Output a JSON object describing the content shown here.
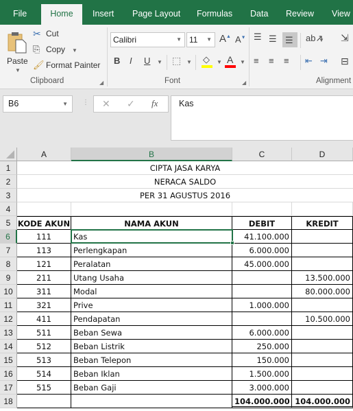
{
  "tabs": [
    "File",
    "Home",
    "Insert",
    "Page Layout",
    "Formulas",
    "Data",
    "Review",
    "View"
  ],
  "active_tab": "Home",
  "ribbon": {
    "clipboard": {
      "label": "Clipboard",
      "paste": "Paste",
      "cut": "Cut",
      "copy": "Copy",
      "format_painter": "Format Painter"
    },
    "font": {
      "label": "Font",
      "font_name": "Calibri",
      "font_size": "11",
      "bold": "B",
      "italic": "I",
      "underline": "U",
      "highlight_color": "#ffff00",
      "font_color": "#ff0000"
    },
    "alignment": {
      "label": "Alignment"
    }
  },
  "formula_bar": {
    "name_box": "B6",
    "cancel": "✕",
    "enter": "✓",
    "fx": "fx",
    "value": "Kas"
  },
  "columns": [
    "A",
    "B",
    "C",
    "D"
  ],
  "selected_column": "B",
  "selected_row": 6,
  "rows": [
    "1",
    "2",
    "3",
    "4",
    "5",
    "6",
    "7",
    "8",
    "9",
    "10",
    "11",
    "12",
    "13",
    "14",
    "15",
    "16",
    "17",
    "18"
  ],
  "sheet": {
    "title1": "CIPTA JASA KARYA",
    "title2": "NERACA SALDO",
    "title3": "PER 31 AGUSTUS 2016",
    "headers": {
      "kode": "KODE AKUN",
      "nama": "NAMA AKUN",
      "debit": "DEBIT",
      "kredit": "KREDIT"
    },
    "entries": [
      {
        "kode": "111",
        "nama": "Kas",
        "debit": "41.100.000",
        "kredit": ""
      },
      {
        "kode": "113",
        "nama": "Perlengkapan",
        "debit": "6.000.000",
        "kredit": ""
      },
      {
        "kode": "121",
        "nama": "Peralatan",
        "debit": "45.000.000",
        "kredit": ""
      },
      {
        "kode": "211",
        "nama": "Utang Usaha",
        "debit": "",
        "kredit": "13.500.000"
      },
      {
        "kode": "311",
        "nama": "Modal",
        "debit": "",
        "kredit": "80.000.000"
      },
      {
        "kode": "321",
        "nama": "Prive",
        "debit": "1.000.000",
        "kredit": ""
      },
      {
        "kode": "411",
        "nama": "Pendapatan",
        "debit": "",
        "kredit": "10.500.000"
      },
      {
        "kode": "511",
        "nama": "Beban Sewa",
        "debit": "6.000.000",
        "kredit": ""
      },
      {
        "kode": "512",
        "nama": "Beban Listrik",
        "debit": "250.000",
        "kredit": ""
      },
      {
        "kode": "513",
        "nama": "Beban Telepon",
        "debit": "150.000",
        "kredit": ""
      },
      {
        "kode": "514",
        "nama": "Beban Iklan",
        "debit": "1.500.000",
        "kredit": ""
      },
      {
        "kode": "515",
        "nama": "Beban Gaji",
        "debit": "3.000.000",
        "kredit": ""
      }
    ],
    "total": {
      "debit": "104.000.000",
      "kredit": "104.000.000"
    }
  }
}
